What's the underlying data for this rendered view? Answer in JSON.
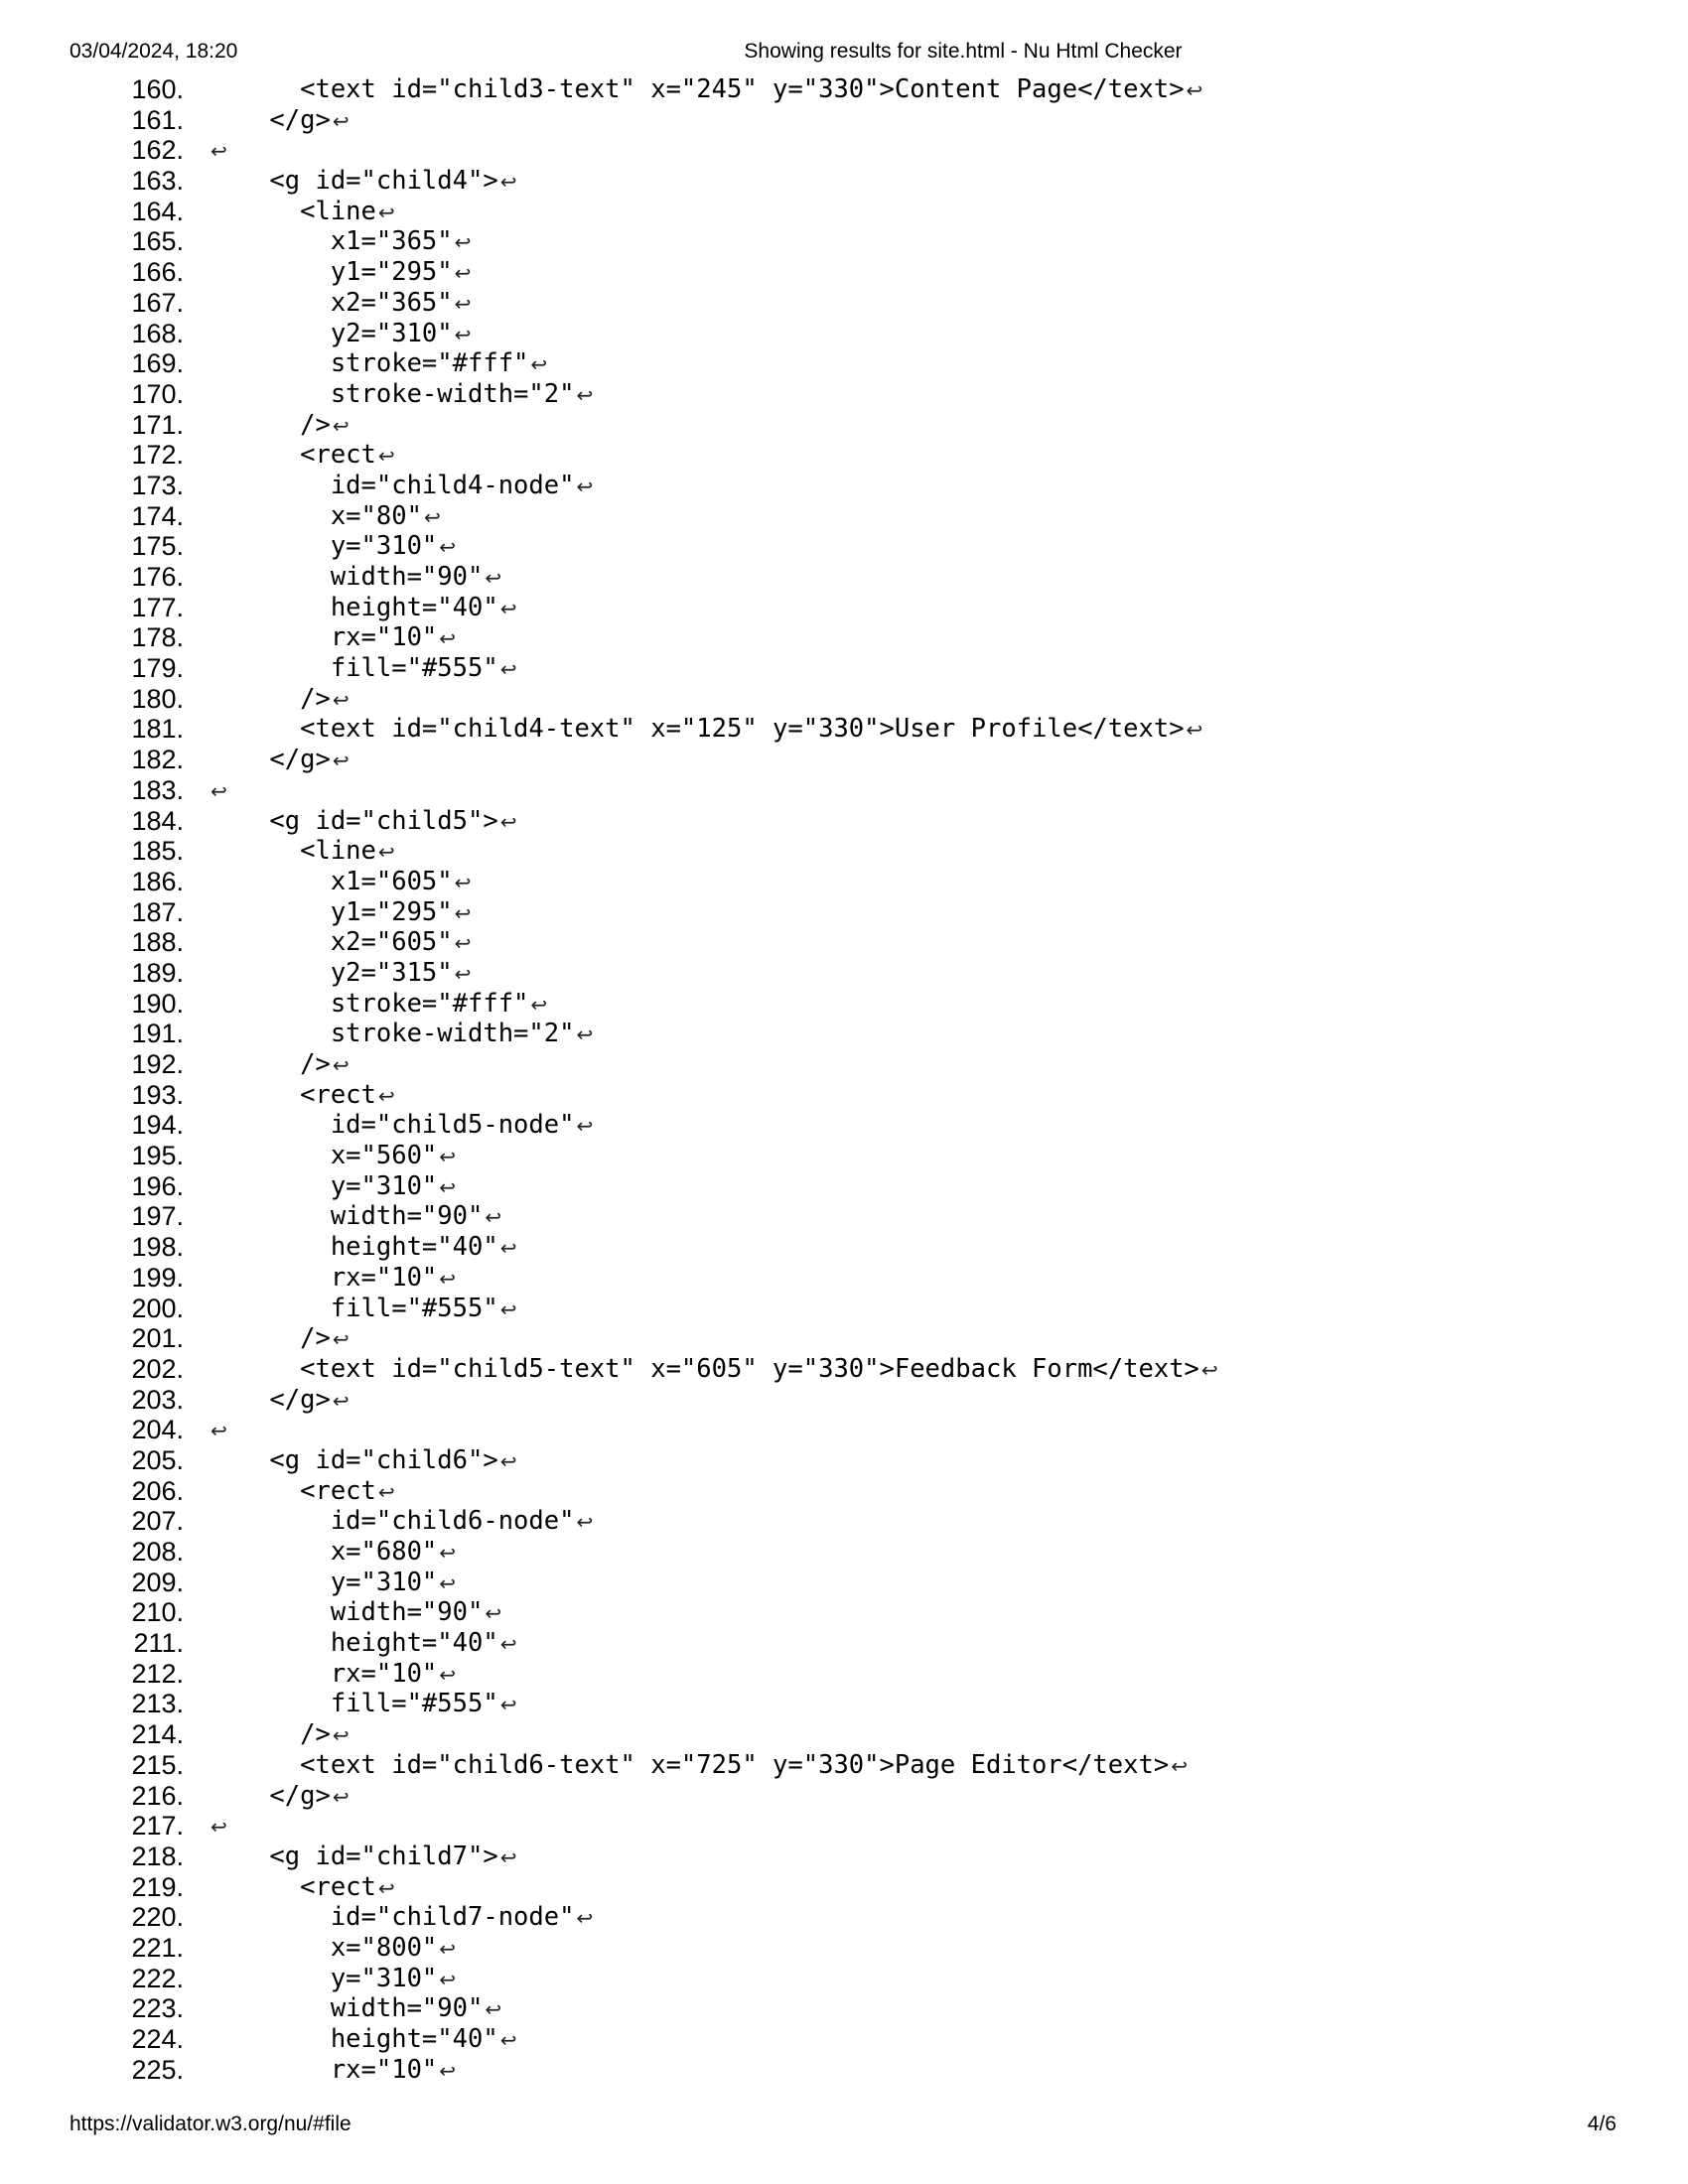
{
  "header": {
    "datetime": "03/04/2024, 18:20",
    "title": "Showing results for site.html - Nu Html Checker"
  },
  "footer": {
    "url": "https://validator.w3.org/nu/#file",
    "page": "4/6"
  },
  "return_symbol": "↩",
  "lines": [
    {
      "n": "160.",
      "t": "      <text id=\"child3-text\" x=\"245\" y=\"330\">Content Page</text>"
    },
    {
      "n": "161.",
      "t": "    </g>"
    },
    {
      "n": "162.",
      "t": ""
    },
    {
      "n": "163.",
      "t": "    <g id=\"child4\">"
    },
    {
      "n": "164.",
      "t": "      <line"
    },
    {
      "n": "165.",
      "t": "        x1=\"365\""
    },
    {
      "n": "166.",
      "t": "        y1=\"295\""
    },
    {
      "n": "167.",
      "t": "        x2=\"365\""
    },
    {
      "n": "168.",
      "t": "        y2=\"310\""
    },
    {
      "n": "169.",
      "t": "        stroke=\"#fff\""
    },
    {
      "n": "170.",
      "t": "        stroke-width=\"2\""
    },
    {
      "n": "171.",
      "t": "      />"
    },
    {
      "n": "172.",
      "t": "      <rect"
    },
    {
      "n": "173.",
      "t": "        id=\"child4-node\""
    },
    {
      "n": "174.",
      "t": "        x=\"80\""
    },
    {
      "n": "175.",
      "t": "        y=\"310\""
    },
    {
      "n": "176.",
      "t": "        width=\"90\""
    },
    {
      "n": "177.",
      "t": "        height=\"40\""
    },
    {
      "n": "178.",
      "t": "        rx=\"10\""
    },
    {
      "n": "179.",
      "t": "        fill=\"#555\""
    },
    {
      "n": "180.",
      "t": "      />"
    },
    {
      "n": "181.",
      "t": "      <text id=\"child4-text\" x=\"125\" y=\"330\">User Profile</text>"
    },
    {
      "n": "182.",
      "t": "    </g>"
    },
    {
      "n": "183.",
      "t": ""
    },
    {
      "n": "184.",
      "t": "    <g id=\"child5\">"
    },
    {
      "n": "185.",
      "t": "      <line"
    },
    {
      "n": "186.",
      "t": "        x1=\"605\""
    },
    {
      "n": "187.",
      "t": "        y1=\"295\""
    },
    {
      "n": "188.",
      "t": "        x2=\"605\""
    },
    {
      "n": "189.",
      "t": "        y2=\"315\""
    },
    {
      "n": "190.",
      "t": "        stroke=\"#fff\""
    },
    {
      "n": "191.",
      "t": "        stroke-width=\"2\""
    },
    {
      "n": "192.",
      "t": "      />"
    },
    {
      "n": "193.",
      "t": "      <rect"
    },
    {
      "n": "194.",
      "t": "        id=\"child5-node\""
    },
    {
      "n": "195.",
      "t": "        x=\"560\""
    },
    {
      "n": "196.",
      "t": "        y=\"310\""
    },
    {
      "n": "197.",
      "t": "        width=\"90\""
    },
    {
      "n": "198.",
      "t": "        height=\"40\""
    },
    {
      "n": "199.",
      "t": "        rx=\"10\""
    },
    {
      "n": "200.",
      "t": "        fill=\"#555\""
    },
    {
      "n": "201.",
      "t": "      />"
    },
    {
      "n": "202.",
      "t": "      <text id=\"child5-text\" x=\"605\" y=\"330\">Feedback Form</text>"
    },
    {
      "n": "203.",
      "t": "    </g>"
    },
    {
      "n": "204.",
      "t": ""
    },
    {
      "n": "205.",
      "t": "    <g id=\"child6\">"
    },
    {
      "n": "206.",
      "t": "      <rect"
    },
    {
      "n": "207.",
      "t": "        id=\"child6-node\""
    },
    {
      "n": "208.",
      "t": "        x=\"680\""
    },
    {
      "n": "209.",
      "t": "        y=\"310\""
    },
    {
      "n": "210.",
      "t": "        width=\"90\""
    },
    {
      "n": "211.",
      "t": "        height=\"40\""
    },
    {
      "n": "212.",
      "t": "        rx=\"10\""
    },
    {
      "n": "213.",
      "t": "        fill=\"#555\""
    },
    {
      "n": "214.",
      "t": "      />"
    },
    {
      "n": "215.",
      "t": "      <text id=\"child6-text\" x=\"725\" y=\"330\">Page Editor</text>"
    },
    {
      "n": "216.",
      "t": "    </g>"
    },
    {
      "n": "217.",
      "t": ""
    },
    {
      "n": "218.",
      "t": "    <g id=\"child7\">"
    },
    {
      "n": "219.",
      "t": "      <rect"
    },
    {
      "n": "220.",
      "t": "        id=\"child7-node\""
    },
    {
      "n": "221.",
      "t": "        x=\"800\""
    },
    {
      "n": "222.",
      "t": "        y=\"310\""
    },
    {
      "n": "223.",
      "t": "        width=\"90\""
    },
    {
      "n": "224.",
      "t": "        height=\"40\""
    },
    {
      "n": "225.",
      "t": "        rx=\"10\""
    }
  ]
}
